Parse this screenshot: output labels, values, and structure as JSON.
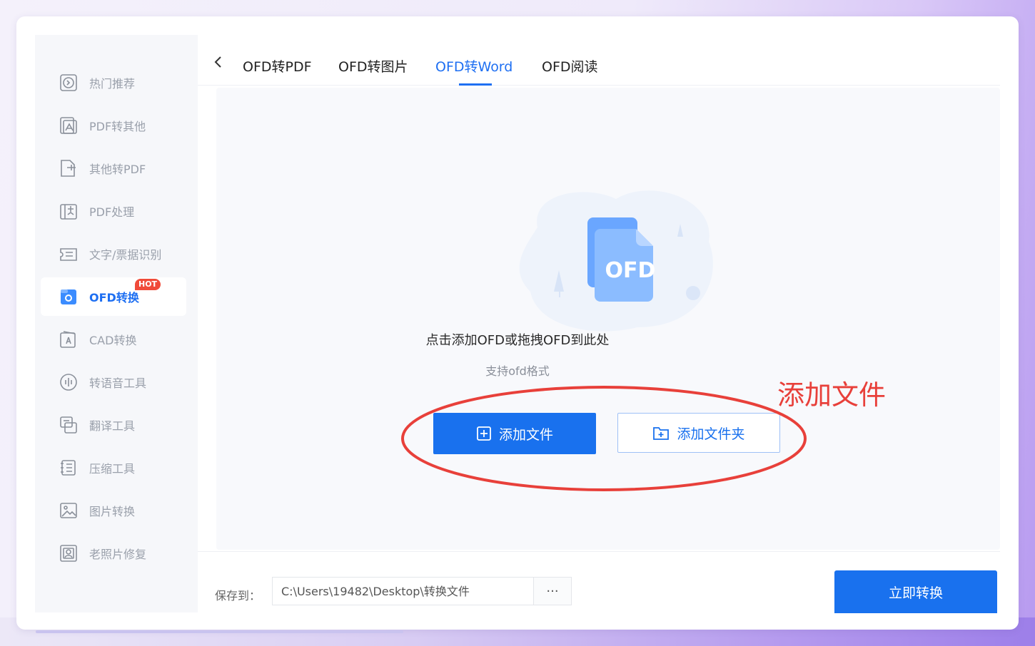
{
  "sidebar": {
    "items": [
      {
        "label": "热门推荐",
        "icon": "hot-recommend-icon"
      },
      {
        "label": "PDF转其他",
        "icon": "pdf-to-other-icon"
      },
      {
        "label": "其他转PDF",
        "icon": "other-to-pdf-icon"
      },
      {
        "label": "PDF处理",
        "icon": "pdf-process-icon"
      },
      {
        "label": "文字/票据识别",
        "icon": "ocr-icon"
      },
      {
        "label": "OFD转换",
        "icon": "ofd-convert-icon",
        "active": true,
        "badge": "HOT"
      },
      {
        "label": "CAD转换",
        "icon": "cad-icon"
      },
      {
        "label": "转语音工具",
        "icon": "voice-icon"
      },
      {
        "label": "翻译工具",
        "icon": "translate-icon"
      },
      {
        "label": "压缩工具",
        "icon": "compress-icon"
      },
      {
        "label": "图片转换",
        "icon": "image-convert-icon"
      },
      {
        "label": "老照片修复",
        "icon": "photo-repair-icon"
      }
    ]
  },
  "tabs": {
    "items": [
      "OFD转PDF",
      "OFD转图片",
      "OFD转Word",
      "OFD阅读"
    ],
    "active": "OFD转Word"
  },
  "dropzone": {
    "illustration_text": "OFD",
    "hint": "点击添加OFD或拖拽OFD到此处",
    "sub_hint": "支持ofd格式",
    "add_file_label": "添加文件",
    "add_folder_label": "添加文件夹"
  },
  "annotation": {
    "text": "添加文件",
    "color": "#e8403a"
  },
  "footer": {
    "save_label": "保存到：",
    "path": "C:\\Users\\19482\\Desktop\\转换文件",
    "browse_label": "···",
    "convert_label": "立即转换"
  },
  "colors": {
    "accent": "#1971ee",
    "badge": "#f04b3a"
  }
}
